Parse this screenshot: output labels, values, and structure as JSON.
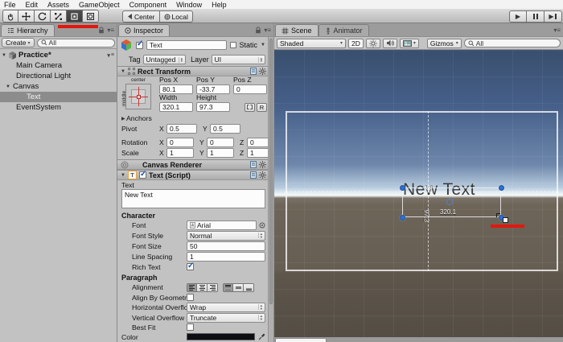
{
  "menu": {
    "items": [
      "File",
      "Edit",
      "Assets",
      "GameObject",
      "Component",
      "Window",
      "Help"
    ]
  },
  "toolbar": {
    "tools": [
      "hand-tool",
      "move-tool",
      "rotate-tool",
      "scale-tool",
      "rect-tool",
      "transform-tool"
    ],
    "active_tool": "rect-tool",
    "pivot_buttons": {
      "center": "Center",
      "local": "Local"
    }
  },
  "icons": {
    "check": "✓",
    "fold_open": "▼",
    "fold_closed": "▶",
    "enum_up": "▴",
    "enum_down": "▾",
    "menu": "≡",
    "play": "▶",
    "step_play": "▶",
    "static_arrow": "▼",
    "text_component": "T"
  },
  "hierarchy": {
    "tab_title": "Hierarchy",
    "create_button": "Create",
    "search_text": "All",
    "items": [
      {
        "label": "Practice*"
      },
      {
        "label": "Main Camera"
      },
      {
        "label": "Directional Light"
      },
      {
        "label": "Canvas"
      },
      {
        "label": "Text"
      },
      {
        "label": "EventSystem"
      }
    ]
  },
  "inspector": {
    "tab_title": "Inspector",
    "header": {
      "name": "Text",
      "static_label": "Static",
      "tag_label": "Tag",
      "tag_value": "Untagged",
      "layer_label": "Layer",
      "layer_value": "UI"
    },
    "rect_transform": {
      "title": "Rect Transform",
      "anchor_top_label": "center",
      "anchor_side_label": "middle",
      "pos_x_label": "Pos X",
      "pos_x": "80.1",
      "pos_y_label": "Pos Y",
      "pos_y": "-33.7",
      "pos_z_label": "Pos Z",
      "pos_z": "0",
      "width_label": "Width",
      "width": "320.1",
      "height_label": "Height",
      "height": "97.3",
      "r_button": "R",
      "anchors_label": "Anchors",
      "pivot_label": "Pivot",
      "pivot_x": "0.5",
      "pivot_y": "0.5",
      "rotation_label": "Rotation",
      "rot_x": "0",
      "rot_y": "0",
      "rot_z": "0",
      "scale_label": "Scale",
      "scale_x": "1",
      "scale_y": "1",
      "scale_z": "1",
      "x": "X",
      "y": "Y",
      "z": "Z"
    },
    "canvas_renderer": {
      "title": "Canvas Renderer"
    },
    "text_script": {
      "title": "Text (Script)",
      "text_label": "Text",
      "text_value": "New Text",
      "character_section": "Character",
      "font_label": "Font",
      "font_value": "Arial",
      "font_style_label": "Font Style",
      "font_style_value": "Normal",
      "font_size_label": "Font Size",
      "font_size_value": "50",
      "line_spacing_label": "Line Spacing",
      "line_spacing_value": "1",
      "rich_text_label": "Rich Text",
      "paragraph_section": "Paragraph",
      "alignment_label": "Alignment",
      "align_by_geometry_label": "Align By Geometr",
      "horizontal_overflow_label": "Horizontal Overflo",
      "horizontal_overflow_value": "Wrap",
      "vertical_overflow_label": "Vertical Overflow",
      "vertical_overflow_value": "Truncate",
      "best_fit_label": "Best Fit",
      "color_label": "Color"
    }
  },
  "scene": {
    "tabs": {
      "scene": "Scene",
      "animator": "Animator"
    },
    "toolbar": {
      "shading_mode": "Shaded",
      "mode_2d": "2D",
      "gizmos": "Gizmos",
      "search_text": "All"
    },
    "viewport": {
      "text_object": "New Text",
      "width_label": "320.1",
      "height_label": "97.3"
    }
  },
  "colors": {
    "annotation_red": "#e2170e",
    "selection_handle_blue": "#2e6fd4",
    "sky_top": "#394f6e",
    "ground": "#665e53",
    "selected_row_gray": "#8c8c8c"
  }
}
